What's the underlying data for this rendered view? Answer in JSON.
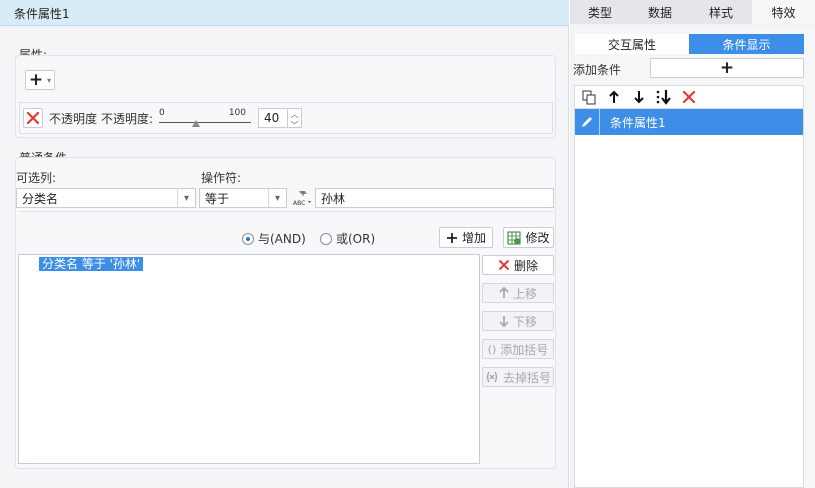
{
  "dialog": {
    "title": "条件属性1"
  },
  "properties": {
    "section_label": "属性:",
    "add_button": "+",
    "opacity_row": {
      "label1": "不透明度",
      "label2": "不透明度:",
      "slider_min": "0",
      "slider_max": "100",
      "slider_value": 40,
      "value": "40"
    }
  },
  "conditions": {
    "section_label": "普通条件",
    "column_label": "可选列:",
    "column_value": "分类名",
    "operator_label": "操作符:",
    "operator_value": "等于",
    "value_text": "孙林",
    "and_label": "与(AND)",
    "or_label": "或(OR)",
    "and_selected": true,
    "add_label": "增加",
    "modify_label": "修改",
    "list": [
      {
        "text": "分类名 等于 '孙林'",
        "selected": true
      }
    ],
    "buttons": {
      "delete": "删除",
      "move_up": "上移",
      "move_down": "下移",
      "add_bracket": "添加括号",
      "remove_bracket": "去掉括号"
    }
  },
  "right_panel": {
    "tabs": [
      {
        "label": "类型",
        "active": false
      },
      {
        "label": "数据",
        "active": false
      },
      {
        "label": "样式",
        "active": false
      },
      {
        "label": "特效",
        "active": true
      }
    ],
    "segments": [
      {
        "label": "交互属性",
        "active": false
      },
      {
        "label": "条件显示",
        "active": true
      }
    ],
    "add_condition_label": "添加条件",
    "add_condition_button": "+",
    "list": [
      {
        "label": "条件属性1",
        "selected": true
      }
    ]
  },
  "colors": {
    "accent": "#3d8ee6",
    "selection": "#3d8ee6",
    "title_bar": "#d8ecf8",
    "delete_red": "#e53935"
  }
}
